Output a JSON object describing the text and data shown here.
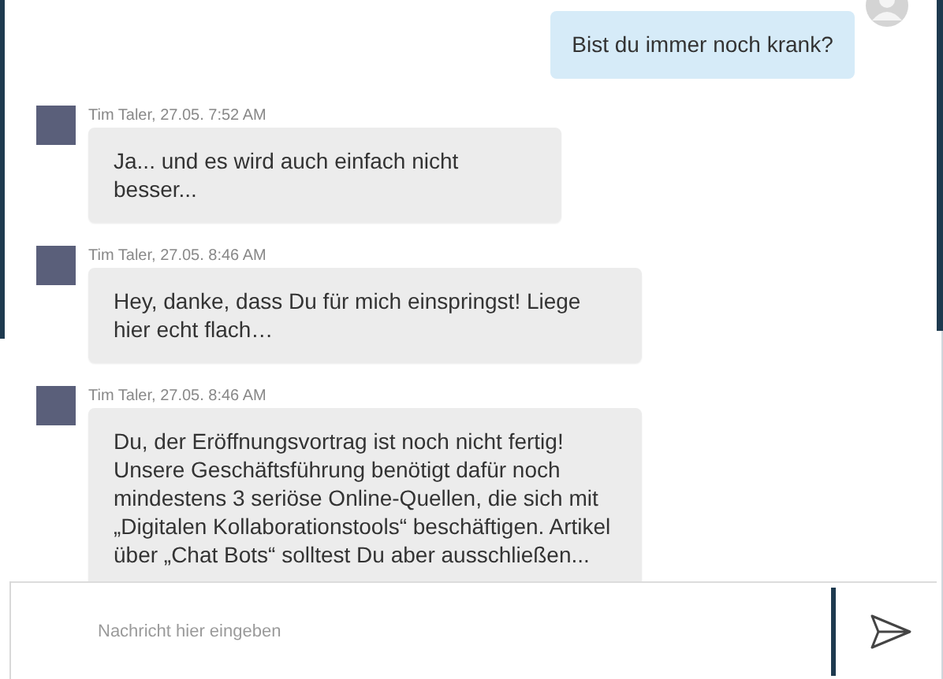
{
  "messages": [
    {
      "kind": "outgoing",
      "text": "Bist du immer noch krank?"
    },
    {
      "kind": "incoming",
      "sender": "Tim Taler, 27.05. 7:52 AM",
      "text": "Ja... und es wird auch einfach nicht besser..."
    },
    {
      "kind": "incoming",
      "sender": "Tim Taler, 27.05. 8:46 AM",
      "text": "Hey, danke, dass Du für mich einspringst! Liege hier echt flach…"
    },
    {
      "kind": "incoming",
      "sender": "Tim Taler, 27.05. 8:46 AM",
      "text": "Du, der Eröffnungsvortrag ist noch nicht fertig! Unsere Geschäftsführung benötigt dafür noch mindestens 3 seriöse Online-Quellen, die sich mit „Digitalen Kollaborationstools“ beschäftigen. Artikel über „Chat Bots“ solltest Du aber ausschließen..."
    }
  ],
  "composer": {
    "placeholder": "Nachricht hier eingeben"
  }
}
